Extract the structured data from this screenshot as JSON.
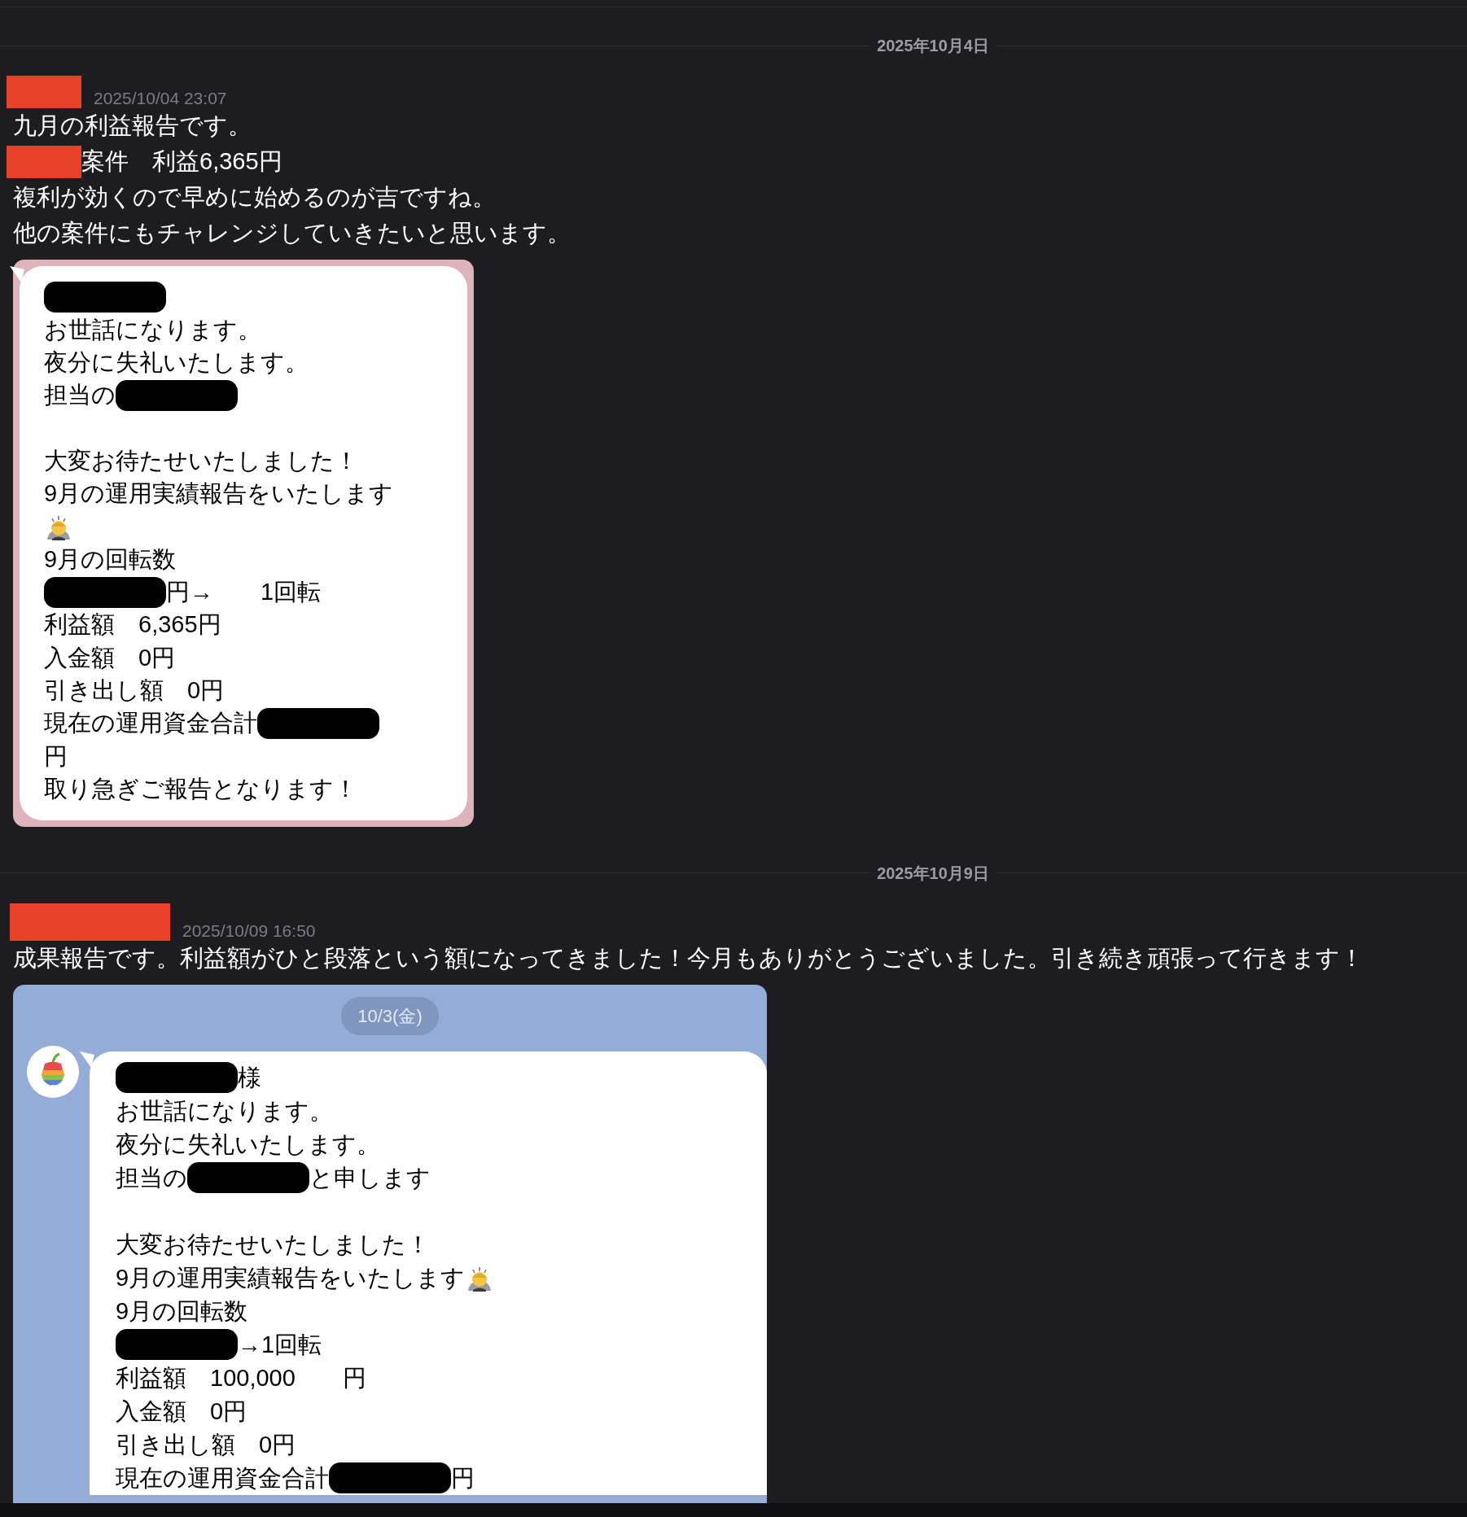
{
  "days": [
    {
      "date": "2025年10月4日",
      "messages": [
        {
          "author": {
            "kind": "redaction"
          },
          "time": "2025/10/04 23:07",
          "lines": [
            {
              "parts": [
                {
                  "kind": "text",
                  "text": "九月の利益報告です。"
                }
              ]
            },
            {
              "parts": [
                {
                  "kind": "redaction"
                },
                {
                  "kind": "text",
                  "text": "案件　利益6,365円"
                }
              ]
            },
            {
              "parts": [
                {
                  "kind": "text",
                  "text": "複利が効くので早めに始めるのが吉ですね。"
                }
              ]
            },
            {
              "parts": [
                {
                  "kind": "text",
                  "text": "他の案件にもチャレンジしていきたいと思います。"
                }
              ]
            }
          ],
          "attachment": {
            "kind": "pink_screenshot",
            "lines": [
              {
                "parts": [
                  {
                    "kind": "redaction"
                  }
                ]
              },
              {
                "parts": [
                  {
                    "kind": "text",
                    "text": "お世話になります。"
                  }
                ]
              },
              {
                "parts": [
                  {
                    "kind": "text",
                    "text": "夜分に失礼いたします。"
                  }
                ]
              },
              {
                "parts": [
                  {
                    "kind": "text",
                    "text": "担当の"
                  },
                  {
                    "kind": "redaction"
                  }
                ]
              },
              {
                "kind": "blank"
              },
              {
                "parts": [
                  {
                    "kind": "text",
                    "text": "大変お待たせいたしました！"
                  }
                ]
              },
              {
                "parts": [
                  {
                    "kind": "text",
                    "text": "9月の運用実績報告をいたします"
                  }
                ]
              },
              {
                "parts": [
                  {
                    "kind": "emoji"
                  }
                ]
              },
              {
                "parts": [
                  {
                    "kind": "text",
                    "text": "9月の回転数"
                  }
                ]
              },
              {
                "parts": [
                  {
                    "kind": "redaction"
                  },
                  {
                    "kind": "text",
                    "text": "円→　　1回転"
                  }
                ]
              },
              {
                "parts": [
                  {
                    "kind": "text",
                    "text": "利益額　6,365円"
                  }
                ]
              },
              {
                "parts": [
                  {
                    "kind": "text",
                    "text": "入金額　0円"
                  }
                ]
              },
              {
                "parts": [
                  {
                    "kind": "text",
                    "text": "引き出し額　0円"
                  }
                ]
              },
              {
                "parts": [
                  {
                    "kind": "text",
                    "text": "現在の運用資金合計"
                  },
                  {
                    "kind": "redaction"
                  }
                ]
              },
              {
                "parts": [
                  {
                    "kind": "text",
                    "text": "円"
                  }
                ]
              },
              {
                "parts": [
                  {
                    "kind": "text",
                    "text": "取り急ぎご報告となります！"
                  }
                ]
              }
            ]
          }
        }
      ]
    },
    {
      "date": "2025年10月9日",
      "messages": [
        {
          "author": {
            "kind": "redaction"
          },
          "time": "2025/10/09 16:50",
          "lines": [
            {
              "parts": [
                {
                  "kind": "text",
                  "text": "成果報告です。利益額がひと段落という額になってきました！今月もありがとうございました。引き続き頑張って行きます！"
                }
              ]
            }
          ],
          "attachment": {
            "kind": "blue_screenshot",
            "date_pill": "10/3(金)",
            "avatar": true,
            "lines": [
              {
                "parts": [
                  {
                    "kind": "redaction"
                  },
                  {
                    "kind": "text",
                    "text": "様"
                  }
                ]
              },
              {
                "parts": [
                  {
                    "kind": "text",
                    "text": "お世話になります。"
                  }
                ]
              },
              {
                "parts": [
                  {
                    "kind": "text",
                    "text": "夜分に失礼いたします。"
                  }
                ]
              },
              {
                "parts": [
                  {
                    "kind": "text",
                    "text": "担当の"
                  },
                  {
                    "kind": "redaction"
                  },
                  {
                    "kind": "text",
                    "text": "と申します"
                  }
                ]
              },
              {
                "kind": "blank"
              },
              {
                "parts": [
                  {
                    "kind": "text",
                    "text": "大変お待たせいたしました！"
                  }
                ]
              },
              {
                "parts": [
                  {
                    "kind": "text",
                    "text": "9月の運用実績報告をいたします"
                  },
                  {
                    "kind": "emoji"
                  }
                ]
              },
              {
                "parts": [
                  {
                    "kind": "text",
                    "text": "9月の回転数"
                  }
                ]
              },
              {
                "parts": [
                  {
                    "kind": "redaction"
                  },
                  {
                    "kind": "text",
                    "text": "→1回転"
                  }
                ]
              },
              {
                "parts": [
                  {
                    "kind": "text",
                    "text": "利益額　100,000　　円"
                  }
                ]
              },
              {
                "parts": [
                  {
                    "kind": "text",
                    "text": "入金額　0円"
                  }
                ]
              },
              {
                "parts": [
                  {
                    "kind": "text",
                    "text": "引き出し額　0円"
                  }
                ]
              },
              {
                "parts": [
                  {
                    "kind": "text",
                    "text": "現在の運用資金合計"
                  },
                  {
                    "kind": "redaction"
                  },
                  {
                    "kind": "text",
                    "text": "円"
                  }
                ]
              }
            ]
          }
        }
      ]
    }
  ]
}
